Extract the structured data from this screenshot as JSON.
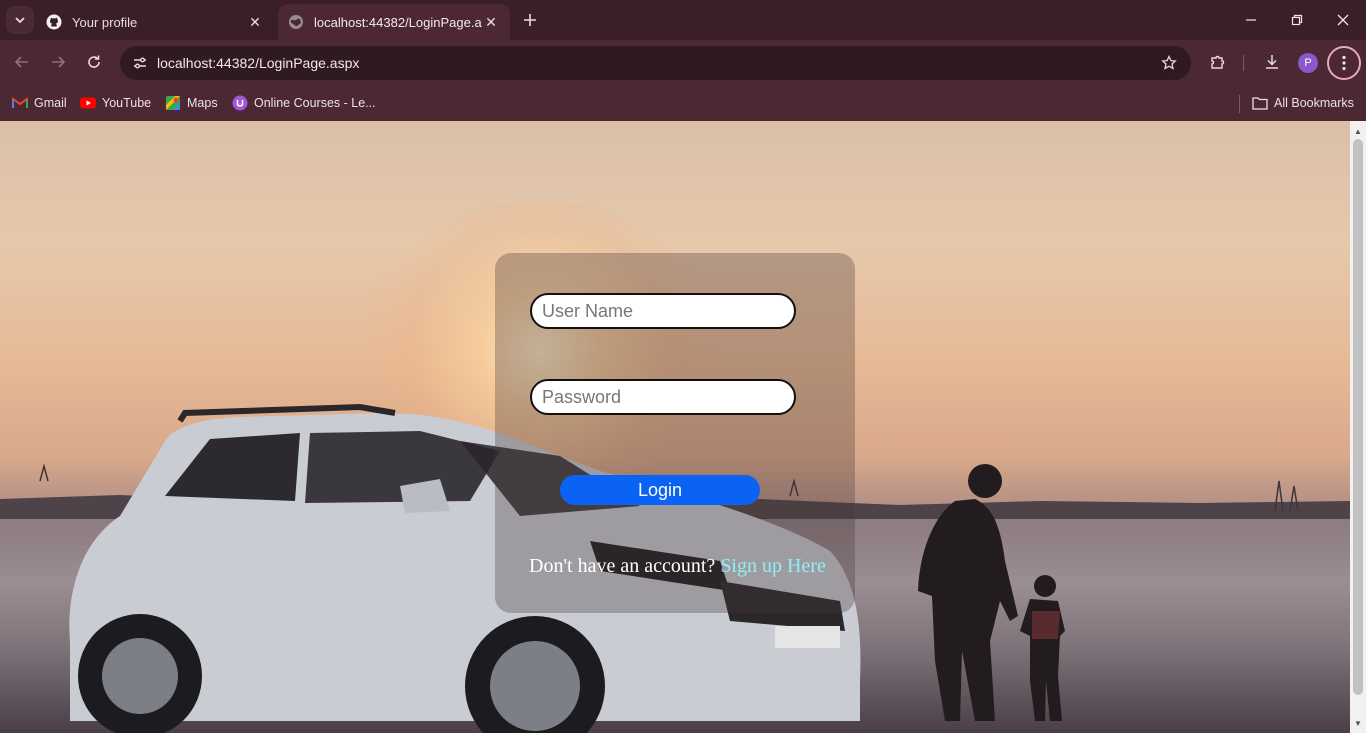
{
  "browser": {
    "tabs": [
      {
        "title": "Your profile",
        "favicon": "github-icon",
        "active": false
      },
      {
        "title": "localhost:44382/LoginPage.aspx",
        "favicon": "globe-icon",
        "active": true
      }
    ],
    "address": "localhost:44382/LoginPage.aspx",
    "profile_initial": "P",
    "bookmarks": [
      {
        "label": "Gmail",
        "icon": "gmail-icon"
      },
      {
        "label": "YouTube",
        "icon": "youtube-icon"
      },
      {
        "label": "Maps",
        "icon": "maps-icon"
      },
      {
        "label": "Online Courses - Le...",
        "icon": "courses-icon"
      }
    ],
    "all_bookmarks_label": "All Bookmarks"
  },
  "login": {
    "username_placeholder": "User Name",
    "password_placeholder": "Password",
    "login_label": "Login",
    "signup_prompt": "Don't have an account?",
    "signup_link": "Sign up Here",
    "button_color": "#0b63f6",
    "link_color": "#8ff0f5"
  }
}
